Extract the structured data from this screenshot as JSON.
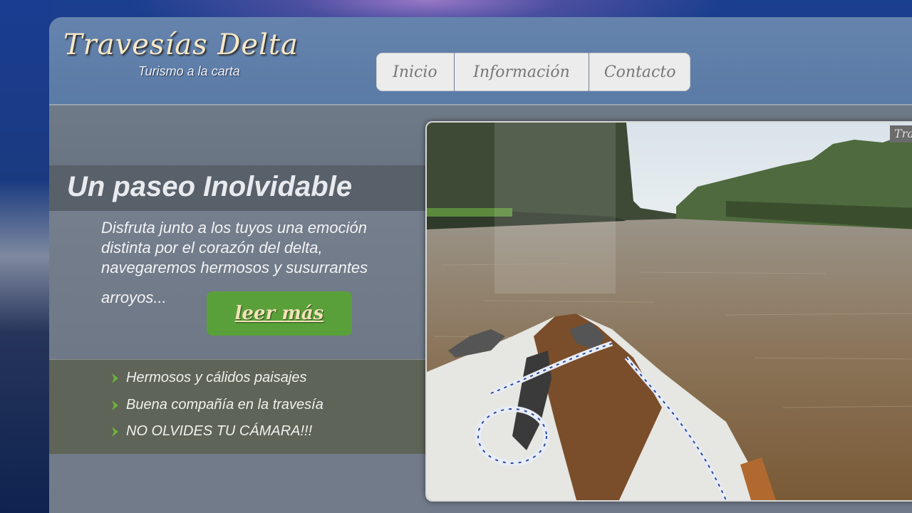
{
  "site": {
    "title": "Travesías Delta",
    "subtitle": "Turismo a la carta"
  },
  "nav": {
    "items": [
      {
        "label": "Inicio"
      },
      {
        "label": "Información"
      },
      {
        "label": "Contacto"
      }
    ]
  },
  "hero": {
    "headline": "Un paseo Inolvidable",
    "description": "Disfruta junto a los tuyos una emoción distinta por el corazón del delta, navegaremos hermosos y susurrantes",
    "description_tail": "arroyos...",
    "read_more_label": "leer más"
  },
  "features": {
    "items": [
      {
        "label": "Hermosos y cálidos paisajes"
      },
      {
        "label": "Buena compañía en la travesía"
      },
      {
        "label": "NO OLVIDES TU CÁMARA!!!"
      }
    ]
  },
  "photo": {
    "label": "Tra",
    "icons": [
      "river-boat-photo"
    ]
  },
  "colors": {
    "header_bg": "#5a7ba6",
    "button_green": "#5aa03a",
    "chevron_green": "#6fb43a",
    "logo_cream": "#f6e8c8"
  }
}
